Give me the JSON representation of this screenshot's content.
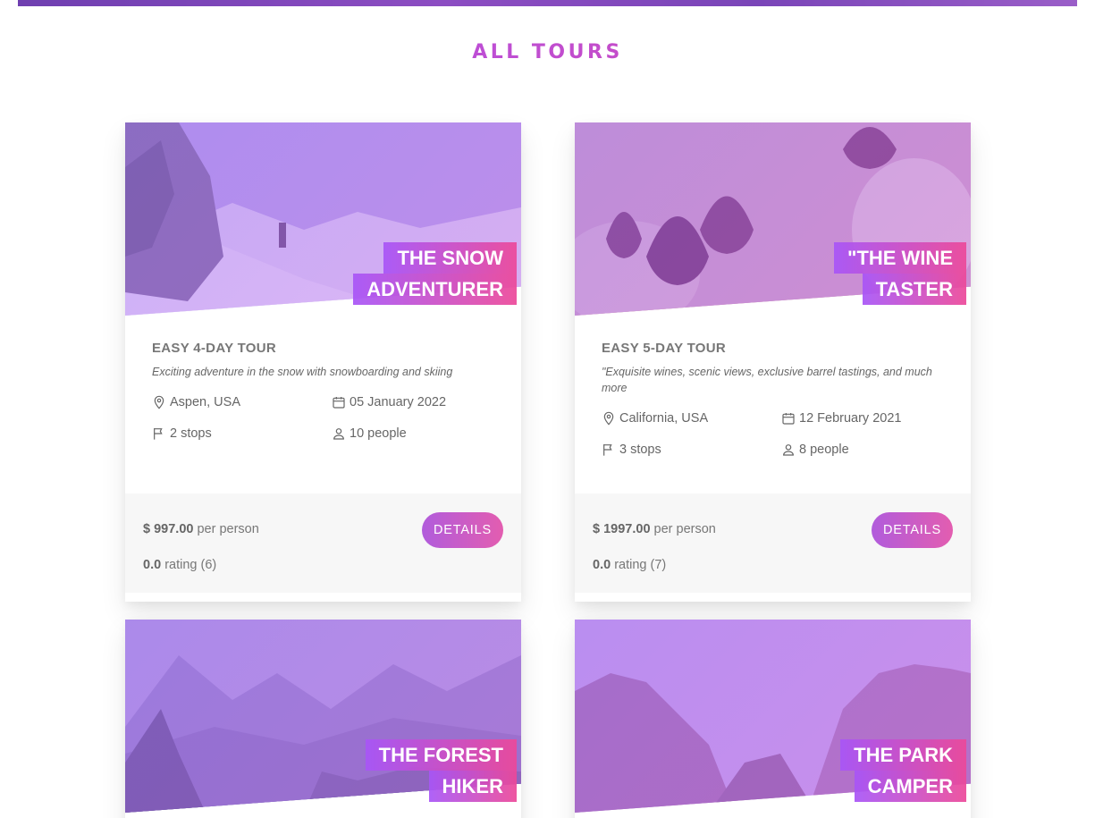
{
  "page": {
    "title": "ALL TOURS"
  },
  "colors": {
    "accent_start": "#a855f7",
    "accent_end": "#ec4899",
    "footer_bg": "#f7f7f7"
  },
  "icons": {
    "location": "map-pin-icon",
    "date": "calendar-icon",
    "stops": "flag-icon",
    "people": "user-icon"
  },
  "tours": [
    {
      "heading_line1": "THE SNOW",
      "heading_line2": "ADVENTURER",
      "subheading": "EASY 4-DAY TOUR",
      "summary": "Exciting adventure in the snow with snowboarding and skiing",
      "location": "Aspen, USA",
      "date": "05 January 2022",
      "stops": "2 stops",
      "people": "10 people",
      "price": "$ 997.00",
      "price_suffix": "per person",
      "rating": "0.0",
      "rating_suffix": "rating (6)",
      "button": "DETAILS"
    },
    {
      "heading_line1": "\"THE WINE",
      "heading_line2": "TASTER",
      "subheading": "EASY 5-DAY TOUR",
      "summary": "\"Exquisite wines, scenic views, exclusive barrel tastings, and much more",
      "location": "California, USA",
      "date": "12 February 2021",
      "stops": "3 stops",
      "people": "8 people",
      "price": "$ 1997.00",
      "price_suffix": "per person",
      "rating": "0.0",
      "rating_suffix": "rating (7)",
      "button": "DETAILS"
    },
    {
      "heading_line1": "THE FOREST",
      "heading_line2": "HIKER"
    },
    {
      "heading_line1": "THE PARK",
      "heading_line2": "CAMPER"
    }
  ]
}
